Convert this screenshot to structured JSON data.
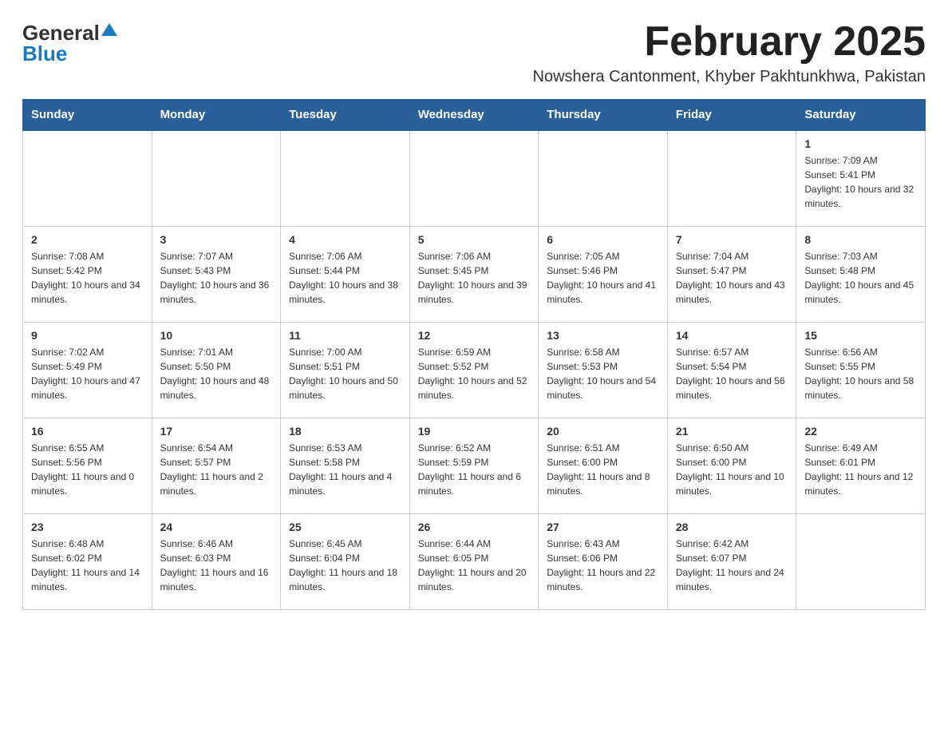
{
  "logo": {
    "general": "General",
    "blue": "Blue"
  },
  "title": "February 2025",
  "subtitle": "Nowshera Cantonment, Khyber Pakhtunkhwa, Pakistan",
  "weekdays": [
    "Sunday",
    "Monday",
    "Tuesday",
    "Wednesday",
    "Thursday",
    "Friday",
    "Saturday"
  ],
  "weeks": [
    [
      {
        "day": "",
        "info": ""
      },
      {
        "day": "",
        "info": ""
      },
      {
        "day": "",
        "info": ""
      },
      {
        "day": "",
        "info": ""
      },
      {
        "day": "",
        "info": ""
      },
      {
        "day": "",
        "info": ""
      },
      {
        "day": "1",
        "info": "Sunrise: 7:09 AM\nSunset: 5:41 PM\nDaylight: 10 hours and 32 minutes."
      }
    ],
    [
      {
        "day": "2",
        "info": "Sunrise: 7:08 AM\nSunset: 5:42 PM\nDaylight: 10 hours and 34 minutes."
      },
      {
        "day": "3",
        "info": "Sunrise: 7:07 AM\nSunset: 5:43 PM\nDaylight: 10 hours and 36 minutes."
      },
      {
        "day": "4",
        "info": "Sunrise: 7:06 AM\nSunset: 5:44 PM\nDaylight: 10 hours and 38 minutes."
      },
      {
        "day": "5",
        "info": "Sunrise: 7:06 AM\nSunset: 5:45 PM\nDaylight: 10 hours and 39 minutes."
      },
      {
        "day": "6",
        "info": "Sunrise: 7:05 AM\nSunset: 5:46 PM\nDaylight: 10 hours and 41 minutes."
      },
      {
        "day": "7",
        "info": "Sunrise: 7:04 AM\nSunset: 5:47 PM\nDaylight: 10 hours and 43 minutes."
      },
      {
        "day": "8",
        "info": "Sunrise: 7:03 AM\nSunset: 5:48 PM\nDaylight: 10 hours and 45 minutes."
      }
    ],
    [
      {
        "day": "9",
        "info": "Sunrise: 7:02 AM\nSunset: 5:49 PM\nDaylight: 10 hours and 47 minutes."
      },
      {
        "day": "10",
        "info": "Sunrise: 7:01 AM\nSunset: 5:50 PM\nDaylight: 10 hours and 48 minutes."
      },
      {
        "day": "11",
        "info": "Sunrise: 7:00 AM\nSunset: 5:51 PM\nDaylight: 10 hours and 50 minutes."
      },
      {
        "day": "12",
        "info": "Sunrise: 6:59 AM\nSunset: 5:52 PM\nDaylight: 10 hours and 52 minutes."
      },
      {
        "day": "13",
        "info": "Sunrise: 6:58 AM\nSunset: 5:53 PM\nDaylight: 10 hours and 54 minutes."
      },
      {
        "day": "14",
        "info": "Sunrise: 6:57 AM\nSunset: 5:54 PM\nDaylight: 10 hours and 56 minutes."
      },
      {
        "day": "15",
        "info": "Sunrise: 6:56 AM\nSunset: 5:55 PM\nDaylight: 10 hours and 58 minutes."
      }
    ],
    [
      {
        "day": "16",
        "info": "Sunrise: 6:55 AM\nSunset: 5:56 PM\nDaylight: 11 hours and 0 minutes."
      },
      {
        "day": "17",
        "info": "Sunrise: 6:54 AM\nSunset: 5:57 PM\nDaylight: 11 hours and 2 minutes."
      },
      {
        "day": "18",
        "info": "Sunrise: 6:53 AM\nSunset: 5:58 PM\nDaylight: 11 hours and 4 minutes."
      },
      {
        "day": "19",
        "info": "Sunrise: 6:52 AM\nSunset: 5:59 PM\nDaylight: 11 hours and 6 minutes."
      },
      {
        "day": "20",
        "info": "Sunrise: 6:51 AM\nSunset: 6:00 PM\nDaylight: 11 hours and 8 minutes."
      },
      {
        "day": "21",
        "info": "Sunrise: 6:50 AM\nSunset: 6:00 PM\nDaylight: 11 hours and 10 minutes."
      },
      {
        "day": "22",
        "info": "Sunrise: 6:49 AM\nSunset: 6:01 PM\nDaylight: 11 hours and 12 minutes."
      }
    ],
    [
      {
        "day": "23",
        "info": "Sunrise: 6:48 AM\nSunset: 6:02 PM\nDaylight: 11 hours and 14 minutes."
      },
      {
        "day": "24",
        "info": "Sunrise: 6:46 AM\nSunset: 6:03 PM\nDaylight: 11 hours and 16 minutes."
      },
      {
        "day": "25",
        "info": "Sunrise: 6:45 AM\nSunset: 6:04 PM\nDaylight: 11 hours and 18 minutes."
      },
      {
        "day": "26",
        "info": "Sunrise: 6:44 AM\nSunset: 6:05 PM\nDaylight: 11 hours and 20 minutes."
      },
      {
        "day": "27",
        "info": "Sunrise: 6:43 AM\nSunset: 6:06 PM\nDaylight: 11 hours and 22 minutes."
      },
      {
        "day": "28",
        "info": "Sunrise: 6:42 AM\nSunset: 6:07 PM\nDaylight: 11 hours and 24 minutes."
      },
      {
        "day": "",
        "info": ""
      }
    ]
  ]
}
